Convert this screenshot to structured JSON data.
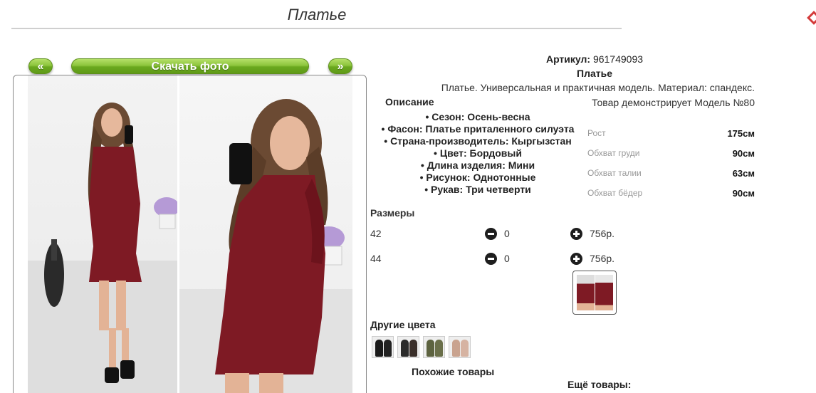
{
  "header": {
    "title": "Платье"
  },
  "gallery": {
    "prev_label": "«",
    "download_label": "Скачать фото",
    "next_label": "»"
  },
  "product": {
    "article_label": "Артикул:",
    "article_value": "961749093",
    "name": "Платье",
    "description": "Платье. Универсальная и практичная модель. Материал: спандекс.",
    "description_heading": "Описание",
    "features": [
      "Сезон: Осень-весна",
      "Фасон: Платье приталенного силуэта",
      "Страна-производитель: Кыргызстан",
      "Цвет: Бордовый",
      "Длина изделия: Мини",
      "Рисунок: Однотонные",
      "Рукав: Три четверти"
    ]
  },
  "model": {
    "title": "Товар демонстрирует Модель №80",
    "measurements": [
      {
        "label": "Рост",
        "value": "175см"
      },
      {
        "label": "Обхват груди",
        "value": "90см"
      },
      {
        "label": "Обхват талии",
        "value": "63см"
      },
      {
        "label": "Обхват бёдер",
        "value": "90см"
      }
    ]
  },
  "sizes": {
    "heading": "Размеры",
    "rows": [
      {
        "size": "42",
        "qty": "0",
        "price": "756р."
      },
      {
        "size": "44",
        "qty": "0",
        "price": "756р."
      }
    ]
  },
  "other_colors": {
    "heading": "Другие цвета"
  },
  "footer": {
    "similar_heading": "Похожие товары",
    "more_heading": "Ещё товары:"
  },
  "colors": {
    "accent_green": "#8cc43c",
    "dress_burgundy": "#7e1a24",
    "corner_icon_red": "#d43a3a"
  },
  "icons": [
    "minus-circle-icon",
    "plus-circle-icon",
    "close-diamond-icon"
  ]
}
